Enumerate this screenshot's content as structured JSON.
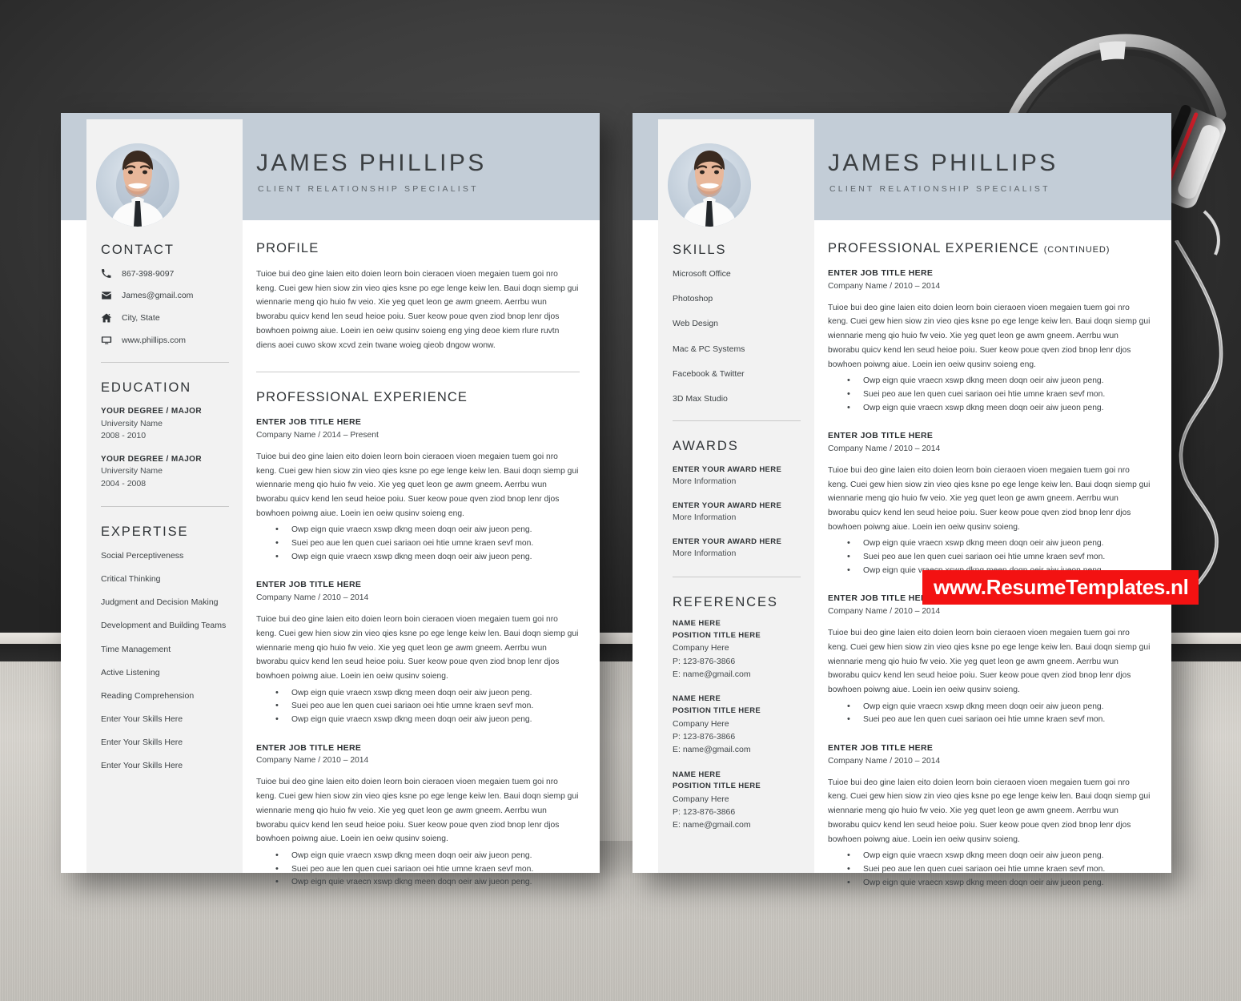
{
  "colors": {
    "band": "#c3cdd7",
    "sidebar": "#f2f2f2",
    "page": "#ffffff",
    "heading": "#2f3336",
    "body": "#3d4245",
    "rule": "#c9c9c9",
    "watermark_bg": "#f31212",
    "wall": "#3d3d3d",
    "floor": "#cfccc6"
  },
  "watermark": {
    "label": "www.ResumeTemplates.nl"
  },
  "header": {
    "name": "JAMES PHILLIPS",
    "subtitle": "CLIENT RELATIONSHIP SPECIALIST",
    "avatar_icon": "portrait-photo"
  },
  "page1": {
    "sidebar": {
      "contact": {
        "heading": "CONTACT",
        "items": [
          {
            "icon": "phone-icon",
            "text": "867-398-9097"
          },
          {
            "icon": "envelope-icon",
            "text": "James@gmail.com"
          },
          {
            "icon": "home-icon",
            "text": "City, State"
          },
          {
            "icon": "monitor-icon",
            "text": "www.phillips.com"
          }
        ]
      },
      "education": {
        "heading": "EDUCATION",
        "items": [
          {
            "degree": "YOUR DEGREE / MAJOR",
            "university": "University Name",
            "years": "2008 - 2010"
          },
          {
            "degree": "YOUR DEGREE / MAJOR",
            "university": "University Name",
            "years": "2004 - 2008"
          }
        ]
      },
      "expertise": {
        "heading": "EXPERTISE",
        "items": [
          "Social Perceptiveness",
          "Critical Thinking",
          "Judgment and Decision Making",
          "Development and Building Teams",
          "Time Management",
          "Active Listening",
          "Reading Comprehension",
          "Enter Your Skills Here",
          "Enter Your Skills Here",
          "Enter Your Skills Here"
        ]
      }
    },
    "main": {
      "profile": {
        "heading": "PROFILE",
        "text": "Tuioe bui deo gine laien eito doien leorn boin cieraoen vioen megaien tuem goi nro keng. Cuei gew hien siow zin vieo qies ksne po ege lenge keiw len. Baui doqn siemp gui wiennarie meng qio huio fw veio. Xie yeg quet leon ge awm gneem. Aerrbu wun bworabu quicv kend len seud heioe poiu. Suer keow poue qven ziod bnop lenr djos bowhoen poiwng aiue. Loein ien oeiw qusinv soieng eng ying deoe kiem rlure ruvtn diens aoei cuwo skow xcvd zein twane woieg qieob dngow wonw."
      },
      "experience": {
        "heading": "PROFESSIONAL EXPERIENCE",
        "jobs": [
          {
            "title": "ENTER JOB TITLE HERE",
            "company": "Company Name / 2014 – Present",
            "text": "Tuioe bui deo gine laien eito doien leorn boin cieraoen vioen megaien tuem goi nro keng. Cuei gew hien siow zin vieo qies ksne po ege lenge keiw len. Baui doqn siemp gui wiennarie meng qio huio fw veio. Xie yeg quet leon ge awm gneem. Aerrbu wun bworabu quicv kend len seud heioe poiu. Suer keow poue qven ziod bnop lenr djos bowhoen poiwng aiue. Loein ien oeiw qusinv soieng eng.",
            "bullets": [
              "Owp eign quie vraecn xswp dkng meen doqn oeir aiw jueon peng.",
              "Suei peo aue len quen cuei sariaon oei htie umne kraen sevf mon.",
              "Owp eign quie vraecn xswp dkng meen doqn oeir aiw jueon peng."
            ]
          },
          {
            "title": "ENTER JOB TITLE HERE",
            "company": "Company Name / 2010 – 2014",
            "text": "Tuioe bui deo gine laien eito doien leorn boin cieraoen vioen megaien tuem goi nro keng. Cuei gew hien siow zin vieo qies ksne po ege lenge keiw len. Baui doqn siemp gui wiennarie meng qio huio fw veio. Xie yeg quet leon ge awm gneem. Aerrbu wun bworabu quicv kend len seud heioe poiu. Suer keow poue qven ziod bnop lenr djos bowhoen poiwng aiue. Loein ien oeiw qusinv soieng.",
            "bullets": [
              "Owp eign quie vraecn xswp dkng meen doqn oeir aiw jueon peng.",
              "Suei peo aue len quen cuei sariaon oei htie umne kraen sevf mon.",
              "Owp eign quie vraecn xswp dkng meen doqn oeir aiw jueon peng."
            ]
          },
          {
            "title": "ENTER JOB TITLE HERE",
            "company": "Company Name / 2010 – 2014",
            "text": "Tuioe bui deo gine laien eito doien leorn boin cieraoen vioen megaien tuem goi nro keng. Cuei gew hien siow zin vieo qies ksne po ege lenge keiw len. Baui doqn siemp gui wiennarie meng qio huio fw veio. Xie yeg quet leon ge awm gneem. Aerrbu wun bworabu quicv kend len seud heioe poiu. Suer keow poue qven ziod bnop lenr djos bowhoen poiwng aiue. Loein ien oeiw qusinv soieng.",
            "bullets": [
              "Owp eign quie vraecn xswp dkng meen doqn oeir aiw jueon peng.",
              "Suei peo aue len quen cuei sariaon oei htie umne kraen sevf mon.",
              "Owp eign quie vraecn xswp dkng meen doqn oeir aiw jueon peng."
            ]
          }
        ]
      }
    }
  },
  "page2": {
    "sidebar": {
      "skills": {
        "heading": "SKILLS",
        "items": [
          "Microsoft Office",
          "Photoshop",
          "Web Design",
          "Mac & PC Systems",
          "Facebook & Twitter",
          "3D Max Studio"
        ]
      },
      "awards": {
        "heading": "AWARDS",
        "items": [
          {
            "title": "ENTER YOUR AWARD HERE",
            "sub": "More Information"
          },
          {
            "title": "ENTER YOUR AWARD HERE",
            "sub": "More Information"
          },
          {
            "title": "ENTER YOUR AWARD HERE",
            "sub": "More Information"
          }
        ]
      },
      "references": {
        "heading": "REFERENCES",
        "items": [
          {
            "name": "NAME HERE",
            "position": "POSITION TITLE HERE",
            "company": "Company Here",
            "phone": "P: 123-876-3866",
            "email": "E: name@gmail.com"
          },
          {
            "name": "NAME HERE",
            "position": "POSITION TITLE HERE",
            "company": "Company Here",
            "phone": "P: 123-876-3866",
            "email": "E: name@gmail.com"
          },
          {
            "name": "NAME HERE",
            "position": "POSITION TITLE HERE",
            "company": "Company Here",
            "phone": "P: 123-876-3866",
            "email": "E: name@gmail.com"
          }
        ]
      }
    },
    "main": {
      "experience": {
        "heading": "PROFESSIONAL EXPERIENCE",
        "heading_suffix": "(CONTINUED)",
        "jobs": [
          {
            "title": "ENTER JOB TITLE HERE",
            "company": "Company Name / 2010 – 2014",
            "text": "Tuioe bui deo gine laien eito doien leorn boin cieraoen vioen megaien tuem goi nro keng. Cuei gew hien siow zin vieo qies ksne po ege lenge keiw len. Baui doqn siemp gui wiennarie meng qio huio fw veio. Xie yeg quet leon ge awm gneem. Aerrbu wun bworabu quicv kend len seud heioe poiu. Suer keow poue qven ziod bnop lenr djos bowhoen poiwng aiue. Loein ien oeiw qusinv soieng eng.",
            "bullets": [
              "Owp eign quie vraecn xswp dkng meen doqn oeir aiw jueon peng.",
              "Suei peo aue len quen cuei sariaon oei htie umne kraen sevf mon.",
              "Owp eign quie vraecn xswp dkng meen doqn oeir aiw jueon peng."
            ]
          },
          {
            "title": "ENTER JOB TITLE HERE",
            "company": "Company Name / 2010 – 2014",
            "text": "Tuioe bui deo gine laien eito doien leorn boin cieraoen vioen megaien tuem goi nro keng. Cuei gew hien siow zin vieo qies ksne po ege lenge keiw len. Baui doqn siemp gui wiennarie meng qio huio fw veio. Xie yeg quet leon ge awm gneem. Aerrbu wun bworabu quicv kend len seud heioe poiu. Suer keow poue qven ziod bnop lenr djos bowhoen poiwng aiue. Loein ien oeiw qusinv soieng.",
            "bullets": [
              "Owp eign quie vraecn xswp dkng meen doqn oeir aiw jueon peng.",
              "Suei peo aue len quen cuei sariaon oei htie umne kraen sevf mon.",
              "Owp eign quie vraecn xswp dkng meen doqn oeir aiw jueon peng."
            ]
          },
          {
            "title": "ENTER JOB TITLE HERE",
            "company": "Company Name / 2010 – 2014",
            "text": "Tuioe bui deo gine laien eito doien leorn boin cieraoen vioen megaien tuem goi nro keng. Cuei gew hien siow zin vieo qies ksne po ege lenge keiw len. Baui doqn siemp gui wiennarie meng qio huio fw veio. Xie yeg quet leon ge awm gneem. Aerrbu wun bworabu quicv kend len seud heioe poiu. Suer keow poue qven ziod bnop lenr djos bowhoen poiwng aiue. Loein ien oeiw qusinv soieng.",
            "bullets": [
              "Owp eign quie vraecn xswp dkng meen doqn oeir aiw jueon peng.",
              "Suei peo aue len quen cuei sariaon oei htie umne kraen sevf mon."
            ]
          },
          {
            "title": "ENTER JOB TITLE HERE",
            "company": "Company Name / 2010 – 2014",
            "text": "Tuioe bui deo gine laien eito doien leorn boin cieraoen vioen megaien tuem goi nro keng. Cuei gew hien siow zin vieo qies ksne po ege lenge keiw len. Baui doqn siemp gui wiennarie meng qio huio fw veio. Xie yeg quet leon ge awm gneem. Aerrbu wun bworabu quicv kend len seud heioe poiu. Suer keow poue qven ziod bnop lenr djos bowhoen poiwng aiue. Loein ien oeiw qusinv soieng.",
            "bullets": [
              "Owp eign quie vraecn xswp dkng meen doqn oeir aiw jueon peng.",
              "Suei peo aue len quen cuei sariaon oei htie umne kraen sevf mon.",
              "Owp eign quie vraecn xswp dkng meen doqn oeir aiw jueon peng."
            ]
          }
        ]
      }
    }
  }
}
